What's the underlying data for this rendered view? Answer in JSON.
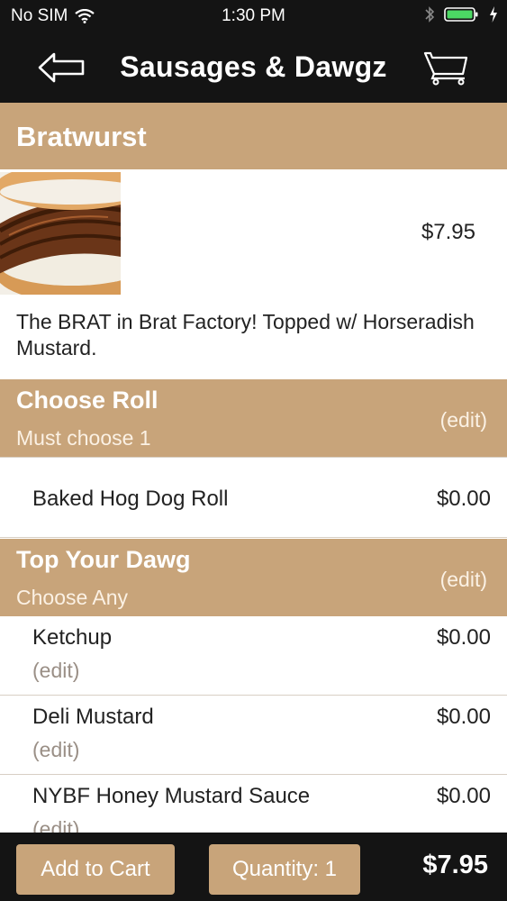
{
  "status_bar": {
    "carrier": "No SIM",
    "time": "1:30 PM"
  },
  "nav": {
    "title": "Sausages & Dawgz",
    "back_icon": "left-arrow-icon",
    "cart_icon": "cart-icon"
  },
  "item": {
    "name": "Bratwurst",
    "price": "$7.95",
    "description": "The BRAT in Brat Factory! Topped w/ Horseradish Mustard."
  },
  "sections": [
    {
      "title": "Choose Roll",
      "subtitle": "Must choose 1",
      "edit_label": "(edit)",
      "options": [
        {
          "name": "Baked Hog Dog Roll",
          "price": "$0.00"
        }
      ]
    },
    {
      "title": "Top Your Dawg",
      "subtitle": "Choose Any",
      "edit_label": "(edit)",
      "options": [
        {
          "name": "Ketchup",
          "price": "$0.00",
          "edit_label": "(edit)"
        },
        {
          "name": "Deli Mustard",
          "price": "$0.00",
          "edit_label": "(edit)"
        },
        {
          "name": "NYBF Honey Mustard Sauce",
          "price": "$0.00",
          "edit_label": "(edit)"
        }
      ]
    }
  ],
  "bottom_bar": {
    "add_to_cart_label": "Add to Cart",
    "quantity_label": "Quantity: 1",
    "total": "$7.95"
  },
  "colors": {
    "accent": "#c8a47a",
    "bar": "#141414",
    "battery": "#4cd964"
  }
}
